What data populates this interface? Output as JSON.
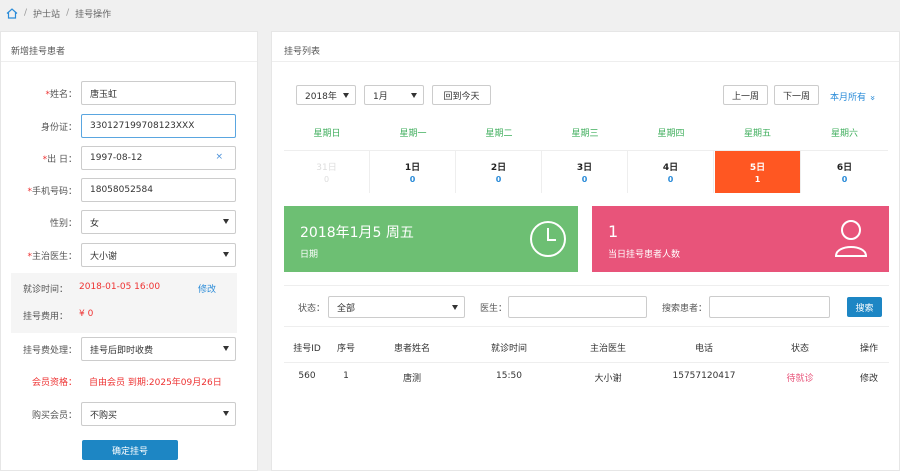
{
  "breadcrumb": [
    "护士站",
    "挂号操作"
  ],
  "left_panel": {
    "title": "新增挂号患者",
    "name_label": "姓名：",
    "name_value": "唐玉虹",
    "id_label": "身份证：",
    "id_value": "330127199708123XXX",
    "birth_label": "出 日：",
    "birth_value": "1997-08-12",
    "clear_icon": "×",
    "phone_label": "手机号码：",
    "phone_value": "18058052584",
    "gender_label": "性别：",
    "gender_value": "女",
    "doctor_label": "主治医生：",
    "doctor_value": "大小谢",
    "visit_time_label": "就诊时间：",
    "visit_time_value": "2018-01-05 16:00",
    "edit_link": "修改",
    "fee_label": "挂号费用：",
    "fee_value": "¥ 0",
    "fee_handling_label": "挂号费处理：",
    "fee_handling_value": "挂号后即时收费",
    "member_label": "会员资格：",
    "member_value": "自由会员 到期:2025年09月26日",
    "buy_member_label": "购买会员：",
    "buy_member_value": "不购买",
    "submit_label": "确定挂号",
    "required_mark": "*"
  },
  "right_panel": {
    "title": "挂号列表",
    "year_select": "2018年",
    "month_select": "1月",
    "today_button": "回到今天",
    "prev_week": "上一周",
    "next_week": "下一周",
    "month_all": "本月所有",
    "month_all_icon": "»",
    "weekdays": [
      "星期日",
      "星期一",
      "星期二",
      "星期三",
      "星期四",
      "星期五",
      "星期六"
    ],
    "days": [
      {
        "label": "31日",
        "count": "0"
      },
      {
        "label": "1日",
        "count": "0"
      },
      {
        "label": "2日",
        "count": "0"
      },
      {
        "label": "3日",
        "count": "0"
      },
      {
        "label": "4日",
        "count": "0"
      },
      {
        "label": "5日",
        "count": "1"
      },
      {
        "label": "6日",
        "count": "0"
      }
    ],
    "date_card": {
      "big": "2018年1月5 周五",
      "small": "日期"
    },
    "count_card": {
      "big": "1",
      "small": "当日挂号患者人数"
    },
    "filter": {
      "status_label": "状态：",
      "status_value": "全部",
      "doctor_label": "医生：",
      "patient_label": "搜索患者：",
      "search_button": "搜索"
    },
    "table": {
      "headers": [
        "挂号ID",
        "序号",
        "患者姓名",
        "就诊时间",
        "主治医生",
        "电话",
        "状态",
        "操作"
      ],
      "rows": [
        [
          "560",
          "1",
          "唐测",
          "15:50",
          "大小谢",
          "15757120417",
          "待就诊",
          "修改"
        ]
      ]
    }
  },
  "colors": {
    "accent_blue": "#1d86c4",
    "today_orange": "#ff5722",
    "green_card": "#6dbf73",
    "pink_card": "#e8547a",
    "red_text": "#e33333"
  }
}
